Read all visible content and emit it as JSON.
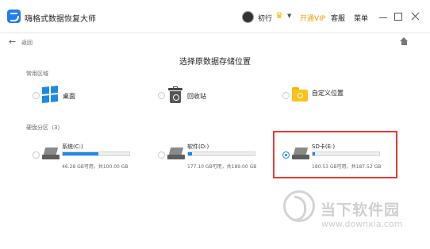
{
  "titlebar": {
    "app_title": "嗨格式数据恢复大师",
    "user_name": "初行",
    "crown_glyph": "♛",
    "vip_label": "开通VIP",
    "service_label": "客服",
    "menu_label": "菜单"
  },
  "nav": {
    "back_label": "返回"
  },
  "page": {
    "heading": "选择原数据存储位置",
    "common_section": "常用区域",
    "disk_section": "硬盘分区（3）"
  },
  "locations": [
    {
      "label": "桌面",
      "icon": "windows-logo-icon"
    },
    {
      "label": "回收站",
      "icon": "recycle-bin-icon"
    },
    {
      "label": "自定义位置",
      "icon": "folder-icon"
    }
  ],
  "drives": [
    {
      "label": "系统(C:)",
      "size_text": "46.28 GB可用，共100.00 GB",
      "used_fraction": 0.54,
      "selected": false
    },
    {
      "label": "软件(D:)",
      "size_text": "177.10 GB可用，共189.00 GB",
      "used_fraction": 0.06,
      "selected": false
    },
    {
      "label": "SD卡(E:)",
      "size_text": "180.53 GB可用，共187.52 GB",
      "used_fraction": 0.04,
      "selected": true
    }
  ],
  "watermark": {
    "text": "当下软件园",
    "url": "www.downxia.com"
  },
  "colors": {
    "accent": "#1f7ff0",
    "vip": "#f39b00",
    "highlight": "#e53935"
  }
}
